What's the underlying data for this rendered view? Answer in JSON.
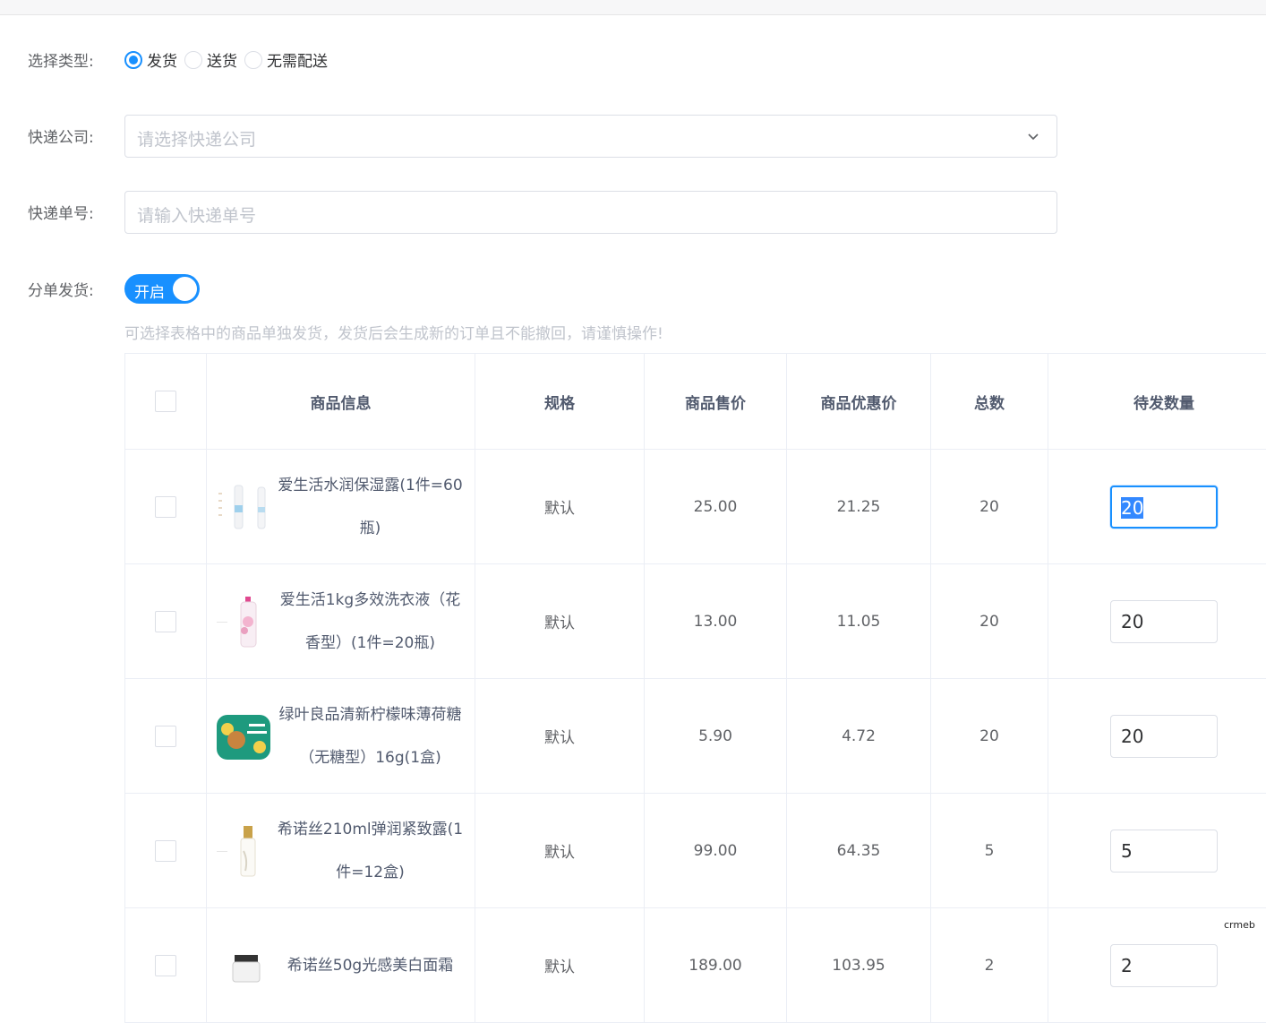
{
  "form": {
    "type_label": "选择类型:",
    "type_options": [
      "发货",
      "送货",
      "无需配送"
    ],
    "type_selected": "发货",
    "express_label": "快递公司:",
    "express_placeholder": "请选择快递公司",
    "tracking_label": "快递单号:",
    "tracking_placeholder": "请输入快递单号",
    "split_label": "分单发货:",
    "split_switch_text": "开启",
    "split_hint": "可选择表格中的商品单独发货，发货后会生成新的订单且不能撤回，请谨慎操作!"
  },
  "table": {
    "headers": [
      "商品信息",
      "规格",
      "商品售价",
      "商品优惠价",
      "总数",
      "待发数量"
    ],
    "rows": [
      {
        "name": "爱生活水润保湿露(1件=60瓶)",
        "spec": "默认",
        "price": "25.00",
        "discount": "21.25",
        "total": "20",
        "pending": "20"
      },
      {
        "name": "爱生活1kg多效洗衣液（花香型）(1件=20瓶)",
        "spec": "默认",
        "price": "13.00",
        "discount": "11.05",
        "total": "20",
        "pending": "20"
      },
      {
        "name": "绿叶良品清新柠檬味薄荷糖（无糖型）16g(1盒)",
        "spec": "默认",
        "price": "5.90",
        "discount": "4.72",
        "total": "20",
        "pending": "20"
      },
      {
        "name": "希诺丝210ml弹润紧致露(1件=12盒)",
        "spec": "默认",
        "price": "99.00",
        "discount": "64.35",
        "total": "5",
        "pending": "5"
      },
      {
        "name": "希诺丝50g光感美白面霜",
        "spec": "默认",
        "price": "189.00",
        "discount": "103.95",
        "total": "2",
        "pending": "2"
      }
    ]
  },
  "watermark": "crmeb",
  "colors": {
    "primary": "#1890ff",
    "border": "#dcdfe6",
    "placeholder": "#c0c4cc"
  }
}
